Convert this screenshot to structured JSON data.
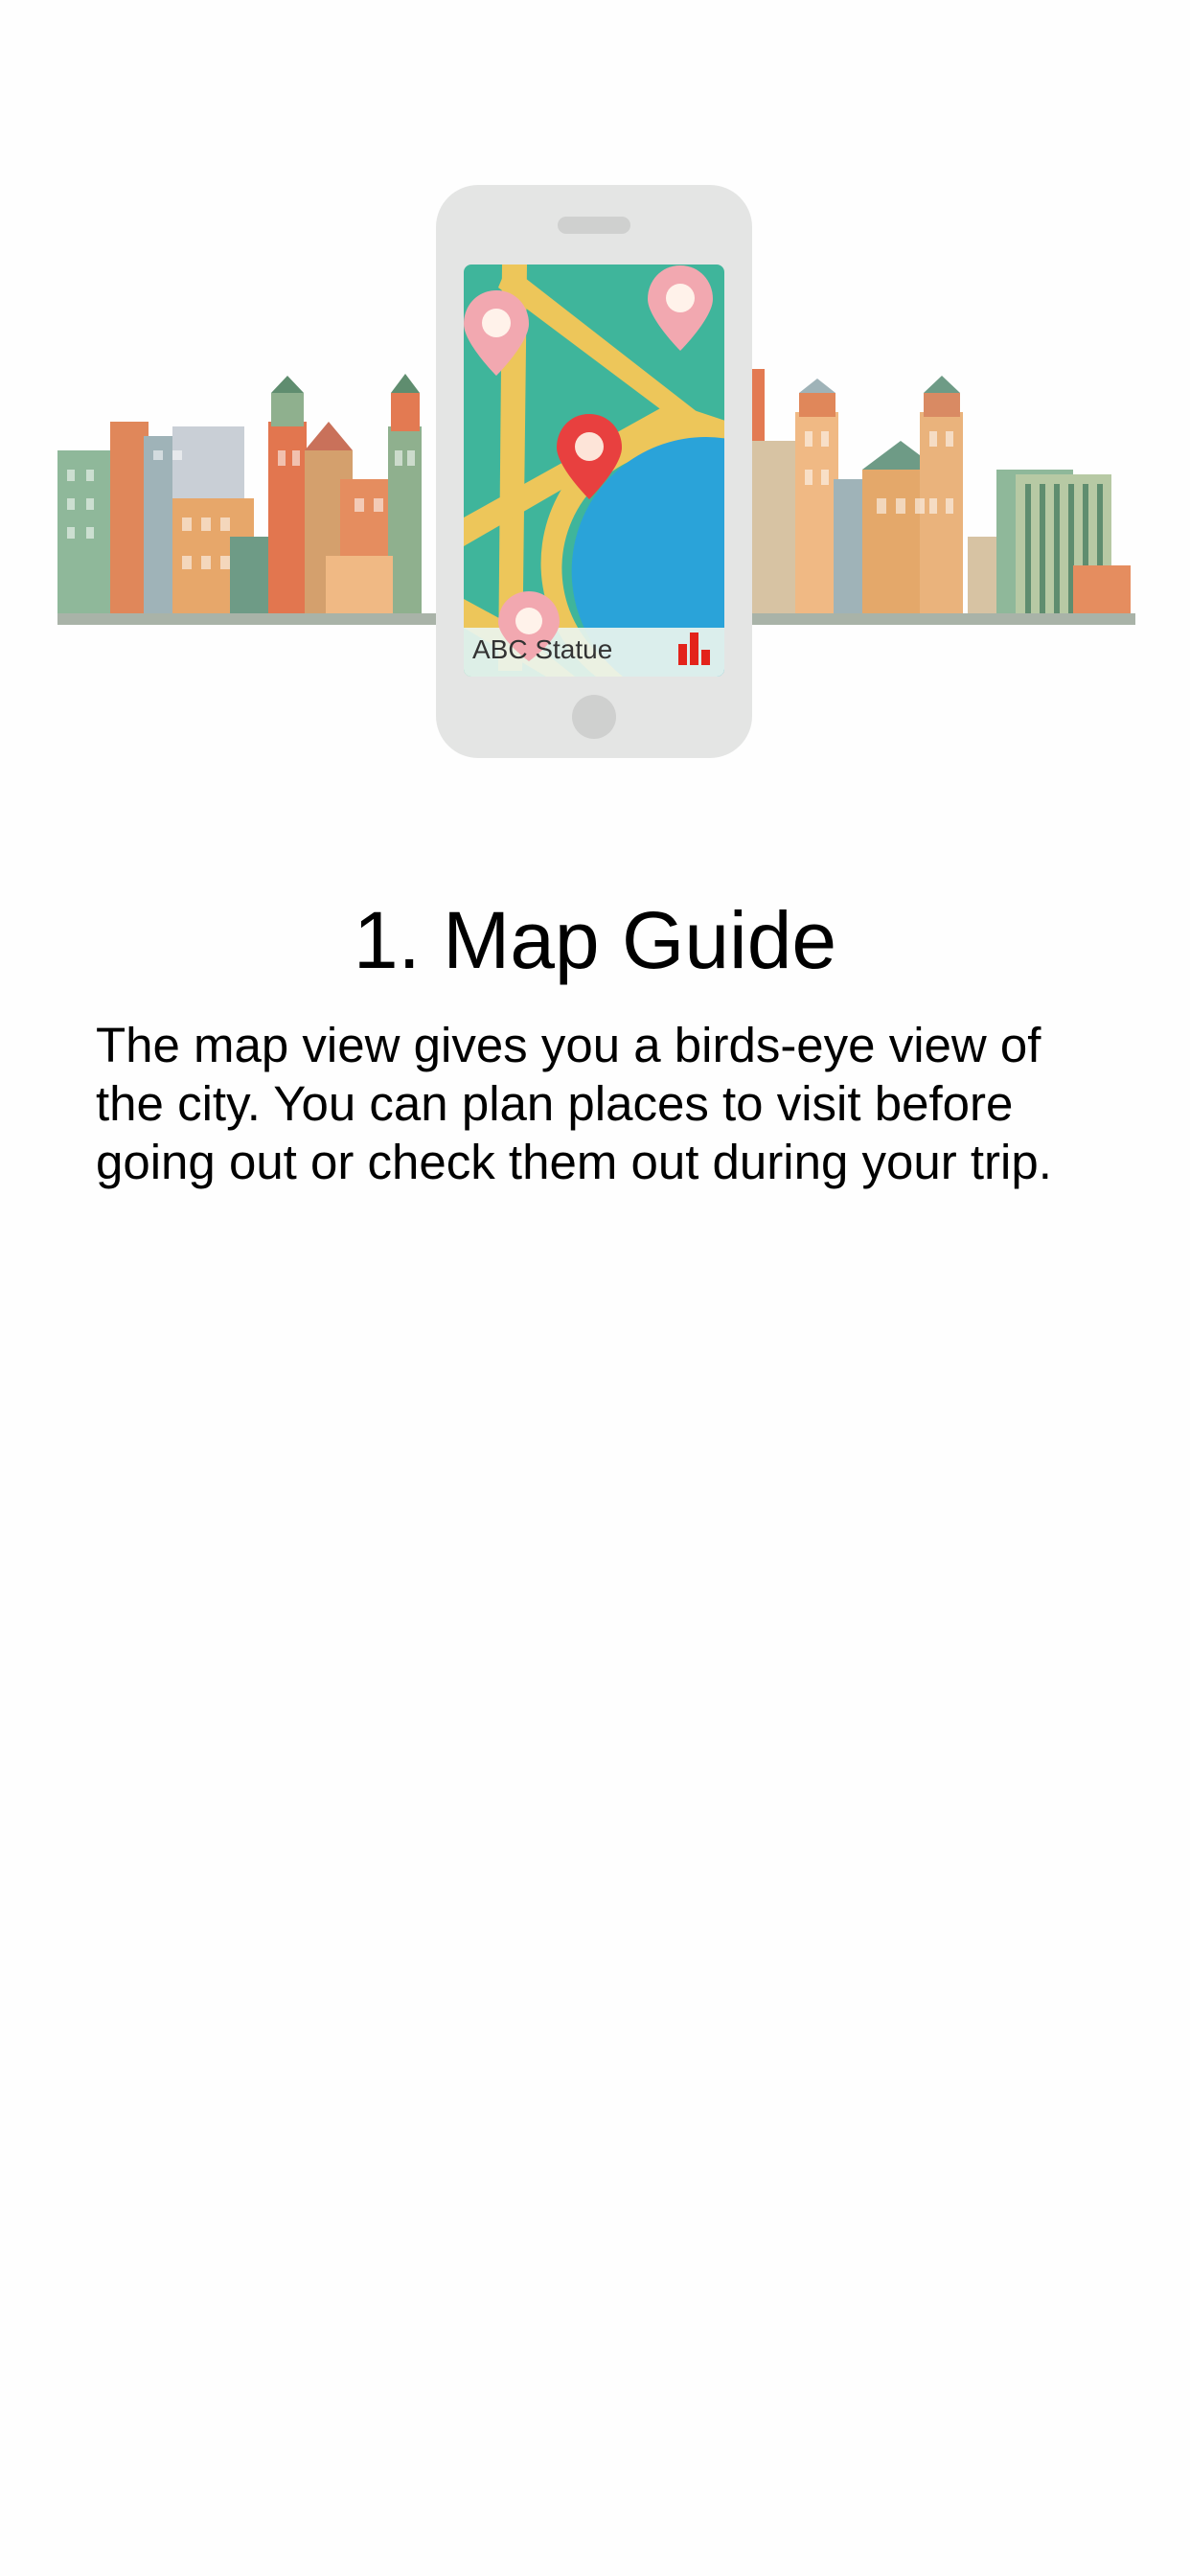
{
  "illustration": {
    "phone_screen_place": "ABC Statue",
    "icons": [
      "map-pin-icon",
      "bar-chart-icon",
      "home-button-icon"
    ],
    "colors": {
      "map_green": "#3fb59b",
      "road_yellow": "#edc65a",
      "water_blue": "#2aa3d9",
      "pin_red": "#e8403f",
      "pin_pink": "#f2a8b0",
      "phone_body": "#e4e5e4"
    }
  },
  "onboarding": {
    "title": "1. Map Guide",
    "description": "The map view gives you a birds-eye view of the city. You can plan places to visit before going out or check them out during your trip."
  }
}
